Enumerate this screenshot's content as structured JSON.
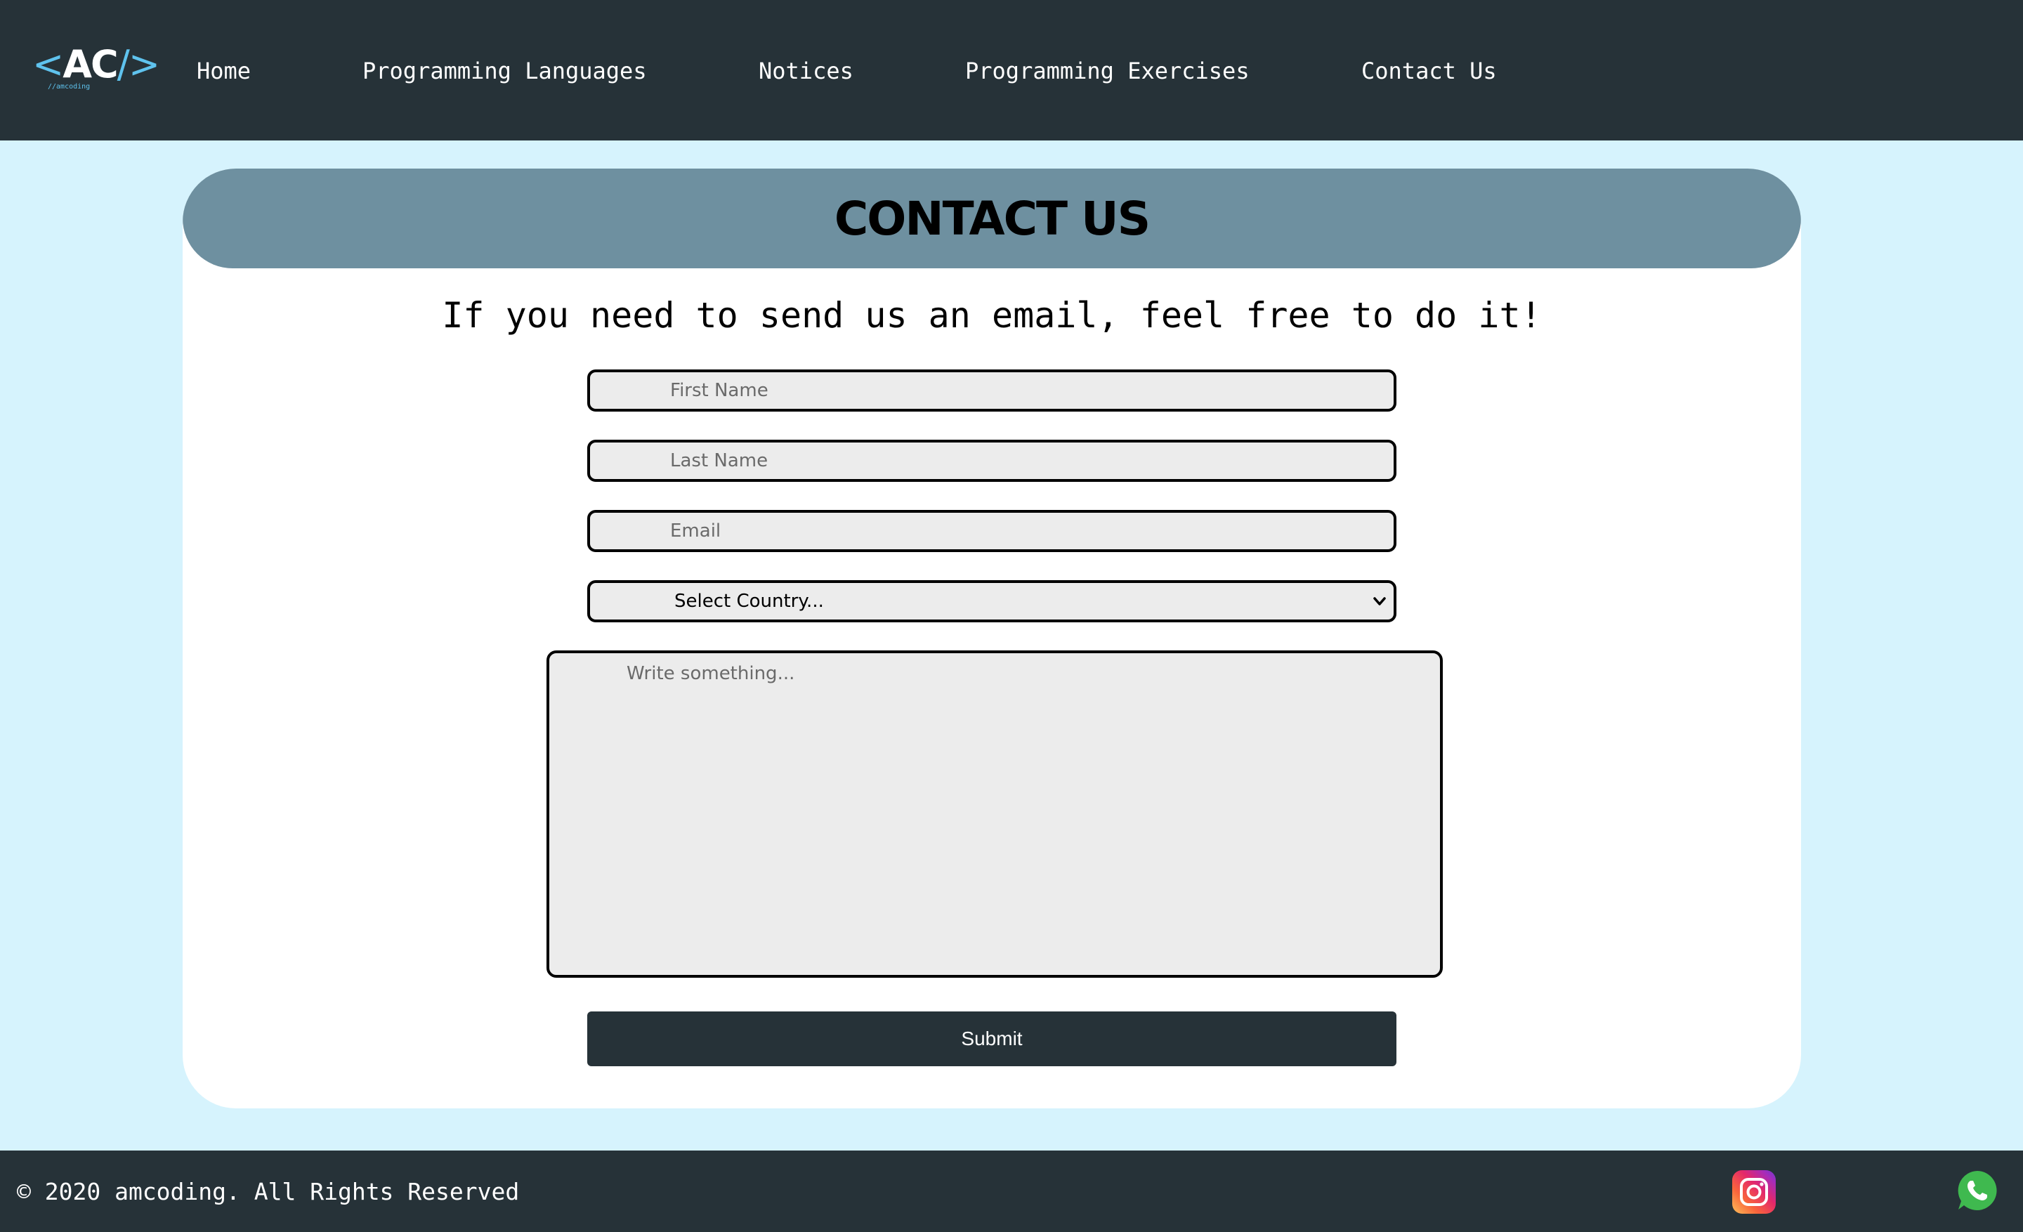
{
  "nav": {
    "logo": {
      "text": "AC",
      "sub": "//amcoding"
    },
    "links": [
      {
        "label": "Home"
      },
      {
        "label": "Programming Languages"
      },
      {
        "label": "Notices"
      },
      {
        "label": "Programming Exercises"
      },
      {
        "label": "Contact Us"
      }
    ]
  },
  "main": {
    "title": "CONTACT US",
    "intro": "If you need to send us an email, feel free to do it!",
    "form": {
      "first_name_placeholder": "First Name",
      "last_name_placeholder": "Last Name",
      "email_placeholder": "Email",
      "country_selected": "Select Country...",
      "message_placeholder": "Write something...",
      "submit_label": "Submit"
    }
  },
  "footer": {
    "copyright": "© 2020 amcoding. All Rights Reserved",
    "social_icons": [
      "instagram-icon",
      "whatsapp-icon"
    ]
  },
  "colors": {
    "nav_bg": "#263238",
    "page_bg": "#d6f3fd",
    "header_bar": "#6e90a0",
    "field_bg": "#ececec",
    "accent": "#5fc3ee",
    "whatsapp": "#3fb94f"
  }
}
